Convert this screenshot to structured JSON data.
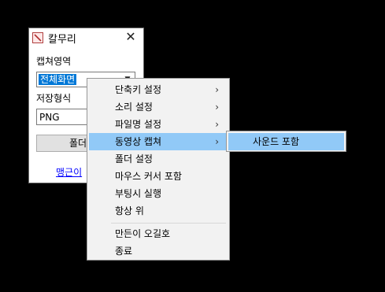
{
  "window": {
    "title": "칼무리",
    "close_glyph": "✕",
    "capture_area_label": "캡쳐영역",
    "capture_area_value": "전체화면",
    "save_format_label": "저장형식",
    "save_format_value": "PNG",
    "folder_button_label": "폴더",
    "link_text": "맹근이"
  },
  "context_menu": {
    "items": [
      {
        "label": "단축키 설정",
        "submenu": "›"
      },
      {
        "label": "소리 설정",
        "submenu": "›"
      },
      {
        "label": "파일명 설정",
        "submenu": "›"
      },
      {
        "label": "동영상 캡쳐",
        "submenu": "›"
      },
      {
        "label": "폴더 설정"
      },
      {
        "label": "마우스 커서 포함"
      },
      {
        "label": "부팅시 실행"
      },
      {
        "label": "항상 위"
      },
      {
        "label": "만든이 오길호"
      },
      {
        "label": "종료"
      }
    ],
    "active_index": 3
  },
  "submenu": {
    "items": [
      {
        "label": "사운드 포함"
      }
    ]
  },
  "colors": {
    "highlight": "#91c9f7",
    "selection": "#0078d7",
    "link": "#0000ff",
    "desktop": "#000000"
  }
}
